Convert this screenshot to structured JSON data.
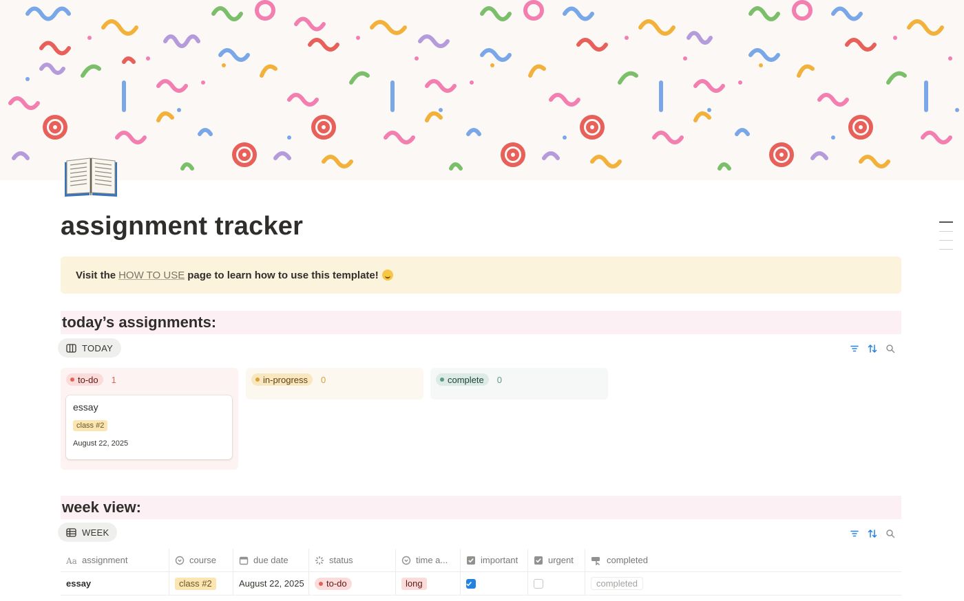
{
  "page": {
    "title": "assignment tracker",
    "icon": "open-book-icon"
  },
  "callout": {
    "prefix": "Visit the",
    "link": "HOW TO USE",
    "suffix": "page to learn how to use this template!",
    "emoji": "smiling-face-icon"
  },
  "today": {
    "heading": "today’s assignments:",
    "view_label": "TODAY",
    "columns": [
      {
        "label": "to-do",
        "count": "1",
        "color": "#e16259"
      },
      {
        "label": "in-progress",
        "count": "0",
        "color": "#d9a23a"
      },
      {
        "label": "complete",
        "count": "0",
        "color": "#5b9a85"
      }
    ],
    "card": {
      "title": "essay",
      "course": "class #2",
      "date": "August 22, 2025"
    }
  },
  "week": {
    "heading": "week view:",
    "view_label": "WEEK",
    "headers": [
      "assignment",
      "course",
      "due date",
      "status",
      "time a...",
      "important",
      "urgent",
      "completed"
    ],
    "row": {
      "assignment": "essay",
      "course": "class #2",
      "due_date": "August 22, 2025",
      "status": "to-do",
      "time": "long",
      "important": true,
      "urgent": false,
      "completed_button": "completed"
    }
  },
  "colors": {
    "accent_blue": "#2383e2",
    "section_bg": "#fdf0f5",
    "callout_bg": "#fbf3db"
  }
}
